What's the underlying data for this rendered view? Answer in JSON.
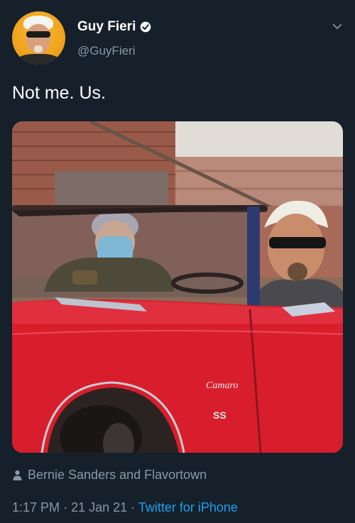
{
  "author": {
    "name": "Guy Fieri",
    "handle": "@GuyFieri",
    "verified": true
  },
  "tweet": {
    "text": "Not me. Us.",
    "location": "Bernie Sanders and Flavortown",
    "time": "1:17 PM",
    "separator": "·",
    "date": "21 Jan 21",
    "source": "Twitter for iPhone"
  },
  "media": {
    "car_badge_script": "Camaro",
    "car_badge_model": "SS"
  },
  "icons": {
    "verified": "verified-badge-icon",
    "menu": "chevron-down-icon",
    "location": "person-icon"
  },
  "colors": {
    "background": "#15202b",
    "text": "#ffffff",
    "muted": "#8899a6",
    "link": "#1da1f2",
    "car_red": "#d81e2c"
  }
}
